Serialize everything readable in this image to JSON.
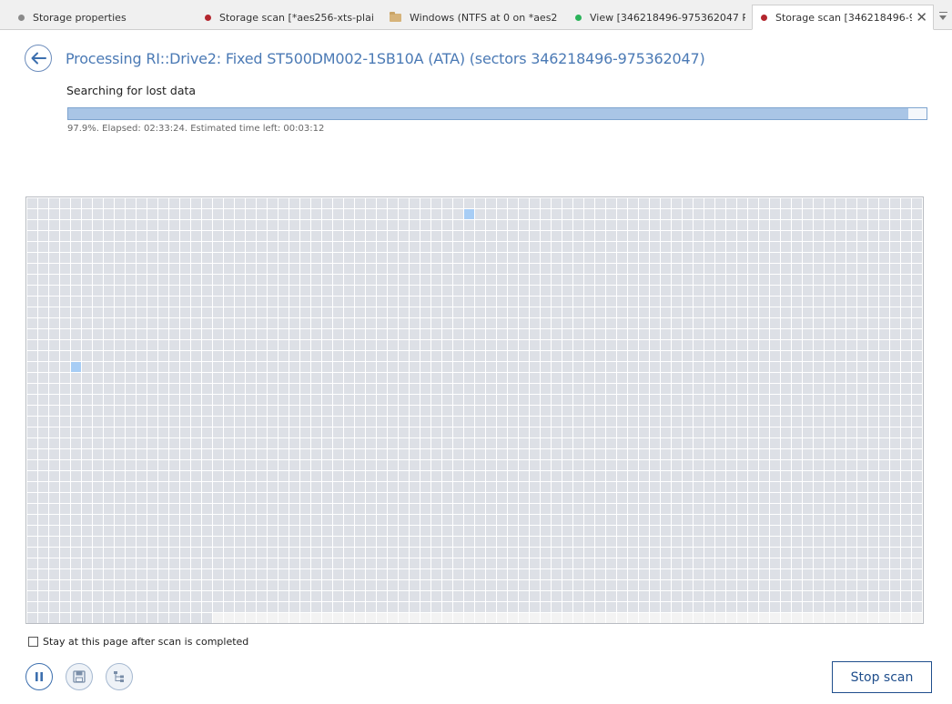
{
  "tabs": [
    {
      "label": "Storage properties",
      "marker": "gray-dot",
      "color": "#8a8a8a",
      "active": false
    },
    {
      "label": "Storage scan [*aes256-xts-plain...",
      "marker": "red-dot",
      "color": "#b3262e",
      "active": false
    },
    {
      "label": "Windows  (NTFS at 0 on *aes2...",
      "marker": "folder-icon",
      "color": "#d6b37a",
      "active": false
    },
    {
      "label": "View [346218496-975362047 RI...",
      "marker": "green-dot",
      "color": "#2bb35a",
      "active": false
    },
    {
      "label": "Storage scan [346218496-9...",
      "marker": "red-dot",
      "color": "#b3262e",
      "active": true
    }
  ],
  "header": {
    "title": "Processing RI::Drive2: Fixed ST500DM002-1SB10A (ATA) (sectors 346218496-975362047)",
    "subtitle": "Searching for lost data"
  },
  "progress": {
    "fraction": 0.979,
    "text": "97.9%. Elapsed: 02:33:24. Estimated time left: 00:03:12"
  },
  "scan_map": {
    "columns": 82,
    "rows": 39,
    "highlighted_cells": [
      [
        40,
        1
      ],
      [
        4,
        15
      ]
    ],
    "unscanned_from_row": 38,
    "unscanned_from_col": 17,
    "colors": {
      "scanned": "#dde0e6",
      "highlight": "#a7cdf5",
      "unscanned": "#f3f3f3",
      "background": "#ffffff"
    }
  },
  "footer": {
    "stay_checkbox_label": "Stay at this page after scan is completed",
    "stay_checkbox_checked": false,
    "buttons": [
      "pause-icon",
      "save-icon",
      "tree-icon"
    ],
    "stop_label": "Stop scan"
  },
  "colors": {
    "accent": "#4b7ab5",
    "stop_border": "#1f4e8c"
  }
}
